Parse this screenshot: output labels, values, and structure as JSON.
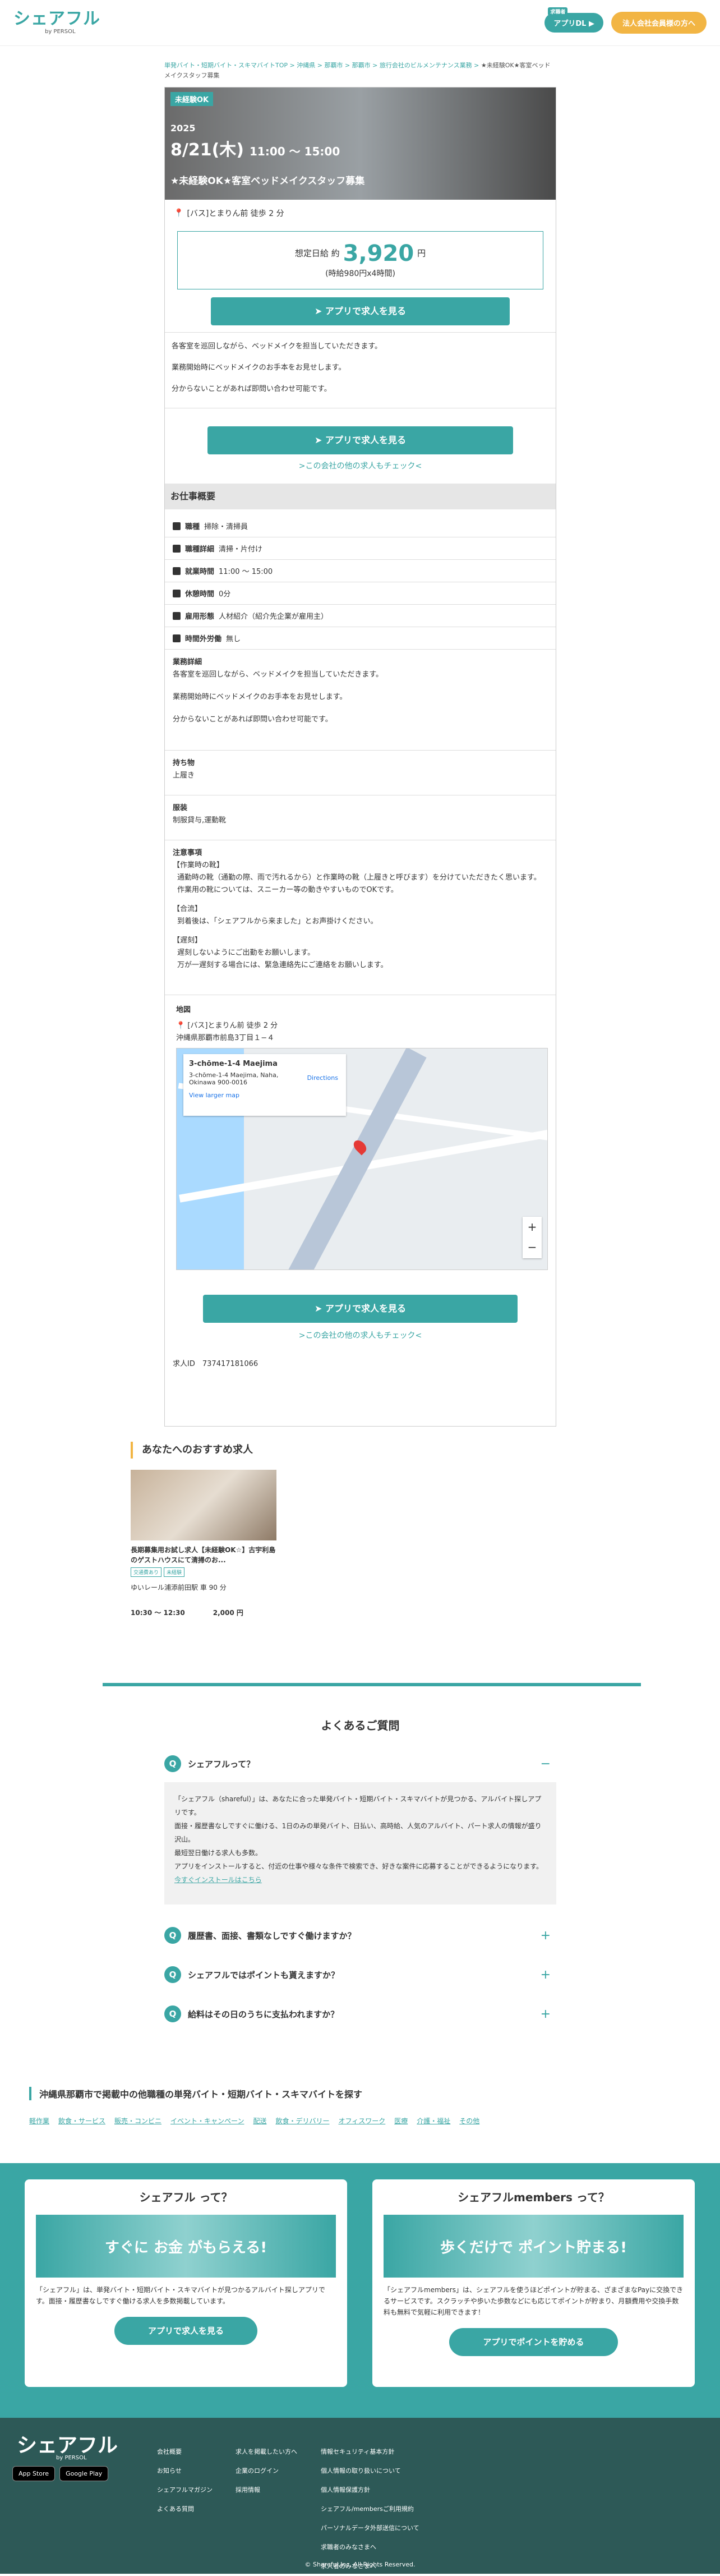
{
  "header": {
    "logo": "シェアフル",
    "logo_sub": "by PERSOL",
    "app_tag": "求職者",
    "app_button": "アプリDL ▶",
    "biz_button": "法人会社会員様の方へ"
  },
  "breadcrumb": {
    "items": [
      "単発バイト・短期バイト・スキマバイトTOP",
      "沖縄県",
      "那覇市",
      "那覇市",
      "旅行会社のビルメンテナンス業務",
      "★未経験OK★客室ベッドメイクスタッフ募集"
    ],
    "current": "★未経験OK★客室ベッドメイクスタッフ募集"
  },
  "job": {
    "badge": "未経験OK",
    "year": "2025",
    "date": "8/21(木)",
    "time": "11:00 ～ 15:00",
    "title": "★未経験OK★客室ベッドメイクスタッフ募集",
    "location": "[バス]とまりん前 徒歩 2 分",
    "wage_label": "想定日給",
    "wage_prefix": "約",
    "wage_value": "3,920",
    "wage_unit": "円",
    "wage_note": "(時給980円x4時間)",
    "apply_button": "アプリで求人を見る",
    "desc_lines": [
      "各客室を巡回しながら、ベッドメイクを担当していただきます。",
      "業務開始時にベッドメイクのお手本をお見せします。",
      "分からないことがあれば即問い合わせ可能です。"
    ],
    "other_jobs_link": ">この会社の他の求人もチェック<",
    "section_title": "お仕事概要",
    "rows": [
      {
        "icon": "briefcase-icon",
        "label": "職種",
        "value": "掃除・清掃員"
      },
      {
        "icon": "id-icon",
        "label": "職種詳細",
        "value": "清掃・片付け"
      },
      {
        "icon": "clock-icon",
        "label": "就業時間",
        "value": "11:00 ～ 15:00"
      },
      {
        "icon": "coffee-icon",
        "label": "休憩時間",
        "value": "0分"
      },
      {
        "icon": "person-icon",
        "label": "雇用形態",
        "value": "人材紹介（紹介先企業が雇用主）"
      },
      {
        "icon": "hourglass-icon",
        "label": "時間外労働",
        "value": "無し"
      }
    ],
    "detail_title": "業務詳細",
    "detail_lines": [
      "各客室を巡回しながら、ベッドメイクを担当していただきます。",
      "業務開始時にベッドメイクのお手本をお見せします。",
      "分からないことがあれば即問い合わせ可能です。"
    ],
    "belongings_title": "持ち物",
    "belongings": "上履き",
    "dress_title": "服装",
    "dress": "制服貸与,運動靴",
    "notes_title": "注意事項",
    "notes_lines": [
      "【作業時の靴】",
      "通勤時の靴（通勤の際、雨で汚れるから）と作業時の靴（上履きと呼びます）を分けていただきたく思います。作業用の靴については、スニーカー等の動きやすいものでOKです。",
      "【合流】",
      "到着後は、「シェアフルから来ました」とお声掛けください。",
      "【遅刻】",
      "遅刻しないようにご出勤をお願いします。",
      "万が一遅刻する場合には、緊急連絡先にご連絡をお願いします。"
    ],
    "map_title": "地図",
    "map_loc": "[バス]とまりん前 徒歩 2 分",
    "map_address": "沖縄県那覇市前島3丁目１−４",
    "map_info_title": "3-chōme-1-4 Maejima",
    "map_info_addr": "3-chōme-1-4 Maejima, Naha, Okinawa 900-0016",
    "map_directions": "Directions",
    "map_larger": "View larger map",
    "job_id_label": "求人ID",
    "job_id": "737417181066"
  },
  "recommend": {
    "title": "あなたへのおすすめ求人",
    "card": {
      "title": "長期募集用お試し求人【未経験OK☆】古宇利島のゲストハウスにて清掃のお...",
      "tags": [
        "交通費あり",
        "未経験"
      ],
      "station": "ゆいレール浦添前田駅 車 90 分",
      "time": "10:30 ～ 12:30",
      "price": "2,000 円"
    }
  },
  "faq": {
    "title": "よくあるご質問",
    "items": [
      {
        "q": "シェアフルって？",
        "open": true
      },
      {
        "q": "履歴書、面接、書類なしですぐ働けますか？",
        "open": false
      },
      {
        "q": "シェアフルではポイントも貰えますか？",
        "open": false
      },
      {
        "q": "給料はその日のうちに支払われますか？",
        "open": false
      }
    ],
    "answer_lines": [
      "「シェアフル（shareful）」は、あなたに合った単発バイト・短期バイト・スキマバイトが見つかる、アルバイト探しアプリです。",
      "面接・履歴書なしですぐに働ける、1日のみの単発バイト、日払い、高時給、人気のアルバイト、パート求人の情報が盛り沢山。",
      "最短翌日働ける求人も多数。",
      "アプリをインストールすると、付近の仕事や様々な条件で検索でき、好きな案件に応募することができるようになります。"
    ],
    "answer_link": "今すぐインストールはこちら"
  },
  "explore": {
    "title": "沖縄県那覇市で掲載中の他職種の単発バイト・短期バイト・スキマバイトを探す",
    "categories": [
      "軽作業",
      "飲食・サービス",
      "販売・コンビニ",
      "イベント・キャンペーン",
      "配送",
      "飲食・デリバリー",
      "オフィスワーク",
      "医療",
      "介護・福祉",
      "その他"
    ]
  },
  "promos": [
    {
      "title": "シェアフル って？",
      "img": "すぐに お金 がもらえる!",
      "text": "「シェアフル」は、単発バイト・短期バイト・スキマバイトが見つかるアルバイト探しアプリです。面接・履歴書なしですぐ働ける求人を多数掲載しています。",
      "button": "アプリで求人を見る"
    },
    {
      "title": "シェアフルmembers って？",
      "img": "歩くだけで ポイント貯まる!",
      "text": "「シェアフルmembers」は、シェアフルを使うほどポイントが貯まる、ざまざまなPayに交換できるサービスです。スクラッチや歩いた歩数などにも応じてポイントが貯まり、月額費用や交換手数料も無料で気軽に利用できます！",
      "button": "アプリでポイントを貯める"
    }
  ],
  "footer": {
    "logo": "シェアフル",
    "logo_sub": "by PERSOL",
    "stores": [
      "App Store",
      "Google Play"
    ],
    "col1": [
      "会社概要",
      "お知らせ",
      "シェアフルマガジン",
      "よくある質問"
    ],
    "col2": [
      "求人を掲載したい方へ",
      "企業のログイン",
      "採用情報"
    ],
    "col3": [
      "情報セキュリティ基本方針",
      "個人情報の取り扱いについて",
      "個人情報保護方針",
      "シェアフル/membersご利用規約",
      "パーソナルデータ外部送信について",
      "求職者のみなさまへ",
      "求人者のみなさまへ"
    ],
    "copyright": "© Shareful,Inc. All Rights Reserved."
  }
}
